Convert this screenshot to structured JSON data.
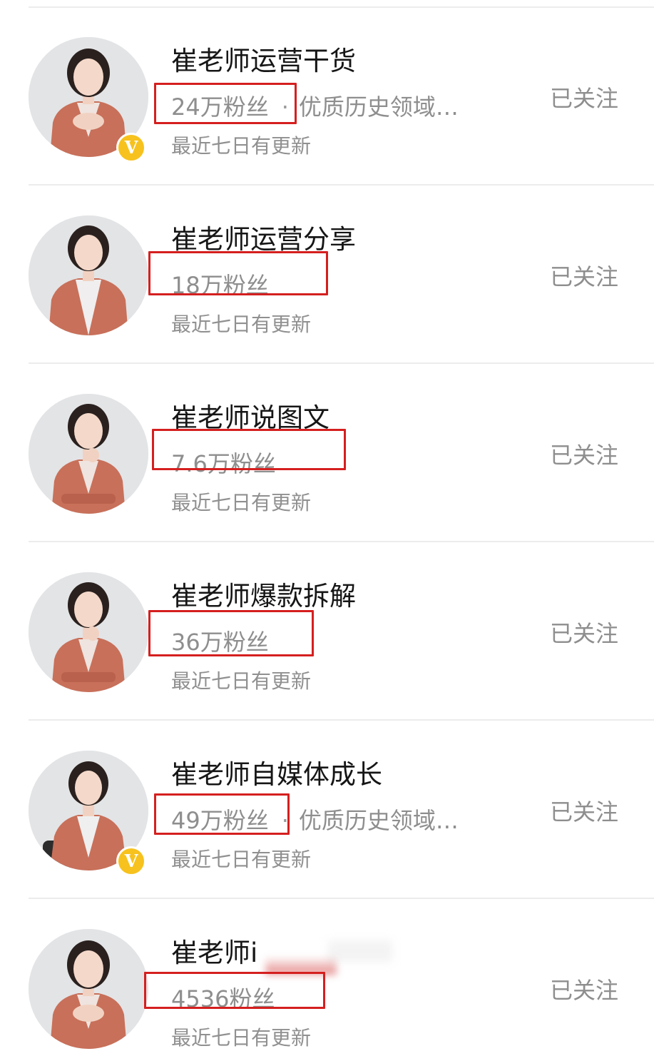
{
  "accounts": [
    {
      "name": "崔老师运营干货",
      "fans": "24万粉丝",
      "tag": "优质历史领域…",
      "update": "最近七日有更新",
      "follow": "已关注",
      "verified": true,
      "verified_badge": "V"
    },
    {
      "name": "崔老师运营分享",
      "fans": "18万粉丝",
      "tag": "",
      "update": "最近七日有更新",
      "follow": "已关注",
      "verified": false
    },
    {
      "name": "崔老师说图文",
      "fans": "7.6万粉丝",
      "tag": "",
      "update": "最近七日有更新",
      "follow": "已关注",
      "verified": false
    },
    {
      "name": "崔老师爆款拆解",
      "fans": "36万粉丝",
      "tag": "",
      "update": "最近七日有更新",
      "follow": "已关注",
      "verified": false
    },
    {
      "name": "崔老师自媒体成长",
      "fans": "49万粉丝",
      "tag": "优质历史领域…",
      "update": "最近七日有更新",
      "follow": "已关注",
      "verified": true,
      "verified_badge": "V"
    },
    {
      "name": "崔老师i",
      "fans": "4536粉丝",
      "tag": "",
      "update": "最近七日有更新",
      "follow": "已关注",
      "verified": false,
      "name_partially_obscured": true
    }
  ],
  "colors": {
    "highlight_box": "#d51f1f",
    "verified_badge": "#f7c21d",
    "name_text": "#161616",
    "secondary_text": "#8e8e8e",
    "divider": "#ececec",
    "blazer": "#c8705a"
  },
  "icons": {
    "separator": "·"
  }
}
